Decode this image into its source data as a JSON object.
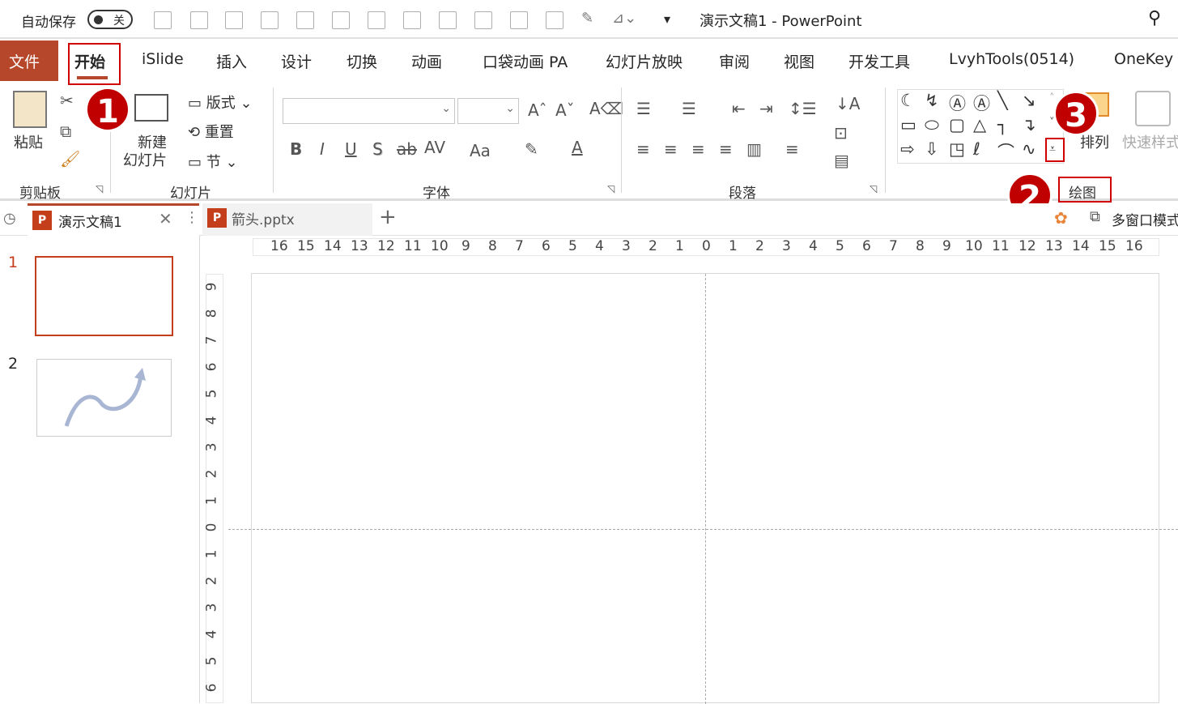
{
  "titlebar": {
    "autosave_label": "自动保存",
    "autosave_state": "关",
    "title": "演示文稿1  -  PowerPoint"
  },
  "tabs": [
    "文件",
    "开始",
    "iSlide",
    "插入",
    "设计",
    "切换",
    "动画",
    "口袋动画 PA",
    "幻灯片放映",
    "审阅",
    "视图",
    "开发工具",
    "LvyhTools(0514)",
    "OneKey"
  ],
  "active_tab": "开始",
  "ribbon": {
    "clipboard": {
      "paste": "粘贴",
      "group": "剪贴板"
    },
    "slides": {
      "new_slide_1": "新建",
      "new_slide_2": "幻灯片",
      "layout": "版式",
      "reset": "重置",
      "section": "节",
      "group": "幻灯片"
    },
    "font": {
      "group": "字体",
      "bold": "B",
      "italic": "I",
      "underline": "U",
      "shadow": "S",
      "strike": "ab",
      "spacing": "AV",
      "case": "Aa"
    },
    "paragraph": {
      "group": "段落"
    },
    "drawing": {
      "arrange": "排列",
      "quick_styles": "快速样式",
      "group": "绘图"
    }
  },
  "annotations": [
    "1",
    "2",
    "3"
  ],
  "doctabs": [
    {
      "label": "演示文稿1",
      "active": true
    },
    {
      "label": "箭头.pptx",
      "active": false
    }
  ],
  "multiwindow": "多窗口模式",
  "slides": [
    {
      "number": "1",
      "selected": true
    },
    {
      "number": "2",
      "selected": false
    }
  ],
  "hruler": [
    "16",
    "15",
    "14",
    "13",
    "12",
    "11",
    "10",
    "9",
    "8",
    "7",
    "6",
    "5",
    "4",
    "3",
    "2",
    "1",
    "0",
    "1",
    "2",
    "3",
    "4",
    "5",
    "6",
    "7",
    "8",
    "9",
    "10",
    "11",
    "12",
    "13",
    "14",
    "15",
    "16"
  ],
  "vruler": [
    "9",
    "8",
    "7",
    "6",
    "5",
    "4",
    "3",
    "2",
    "1",
    "0",
    "1",
    "2",
    "3",
    "4",
    "5",
    "6"
  ],
  "colors": {
    "file_tab": "#b7472a",
    "accent": "#b7472a",
    "annotation": "#c00000"
  }
}
